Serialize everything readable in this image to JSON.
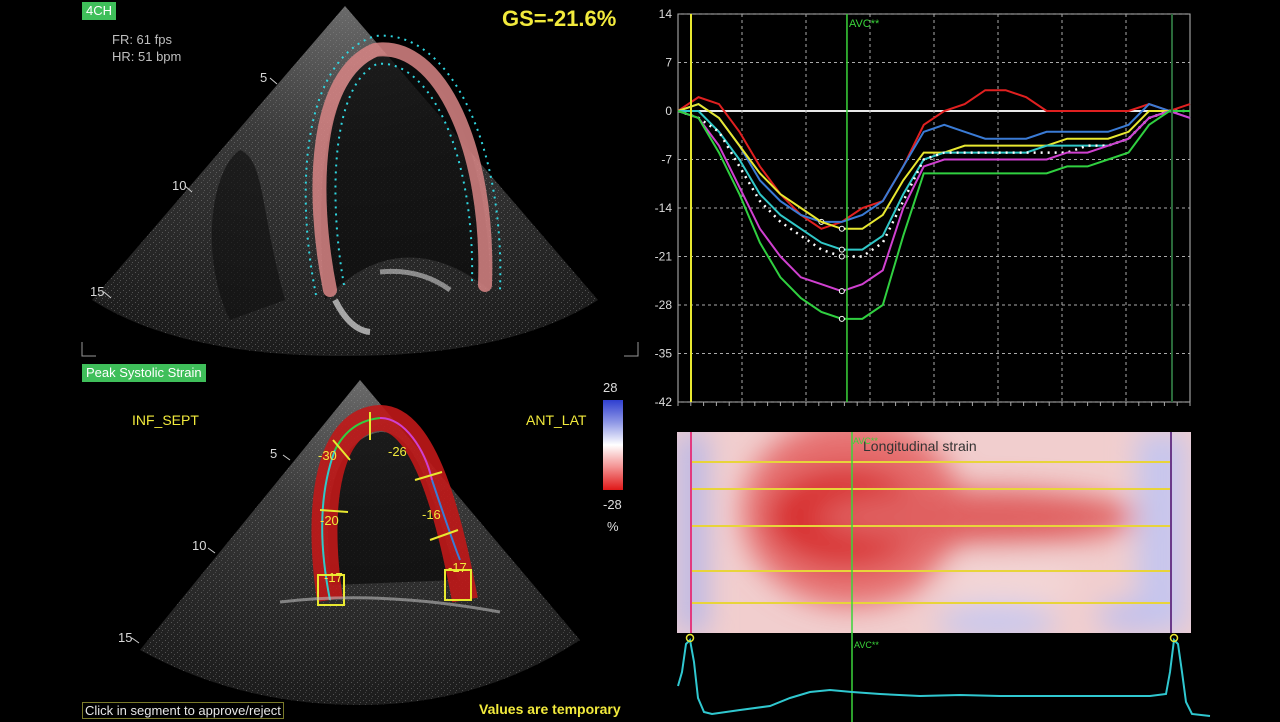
{
  "top_view": {
    "view_label": "4CH",
    "fr": "FR: 61 fps",
    "hr": "HR: 51 bpm",
    "depth_marks": [
      "5",
      "10",
      "15"
    ]
  },
  "gs_value": "GS=-21.6%",
  "bottom_view": {
    "mode_label": "Peak Systolic Strain",
    "left_wall": "INF_SEPT",
    "right_wall": "ANT_LAT",
    "depth_marks": [
      "5",
      "10",
      "15"
    ],
    "segment_values": [
      "-30",
      "-26",
      "-20",
      "-16",
      "-17",
      "-17"
    ],
    "colorbar_max": "28",
    "colorbar_min": "-28",
    "colorbar_unit": "%",
    "colors": {
      "positive": "#2f3fd0",
      "negative": "#e01818"
    }
  },
  "footer": {
    "instruction": "Click in segment to approve/reject",
    "status": "Values are temporary"
  },
  "chart_data": {
    "type": "line",
    "ylabel": "",
    "xlabel": "",
    "ylim": [
      -42,
      14
    ],
    "yticks": [
      "14",
      "7",
      "0",
      "-7",
      "-14",
      "-21",
      "-28",
      "-35",
      "-42"
    ],
    "marker_label": "AVC**",
    "x": [
      0,
      0.04,
      0.08,
      0.12,
      0.16,
      0.2,
      0.24,
      0.28,
      0.32,
      0.36,
      0.4,
      0.44,
      0.48,
      0.52,
      0.56,
      0.6,
      0.64,
      0.68,
      0.72,
      0.76,
      0.8,
      0.84,
      0.88,
      0.92,
      0.96,
      1.0
    ],
    "avc_x": 0.33,
    "series": [
      {
        "color": "#e02020",
        "values": [
          0,
          2,
          1,
          -3,
          -8,
          -12,
          -15,
          -17,
          -16,
          -14,
          -13,
          -8,
          -2,
          0,
          1,
          3,
          3,
          2,
          0,
          0,
          0,
          0,
          0,
          1,
          0,
          1
        ]
      },
      {
        "color": "#3a7bd5",
        "values": [
          0,
          1,
          -1,
          -5,
          -10,
          -13,
          -15,
          -16,
          -16,
          -15,
          -13,
          -8,
          -3,
          -2,
          -3,
          -4,
          -4,
          -4,
          -3,
          -3,
          -3,
          -3,
          -2,
          1,
          0,
          -1
        ]
      },
      {
        "color": "#e8e830",
        "values": [
          0,
          1,
          -1,
          -5,
          -9,
          -12,
          -14,
          -16,
          -17,
          -17,
          -15,
          -10,
          -6,
          -6,
          -5,
          -5,
          -5,
          -5,
          -5,
          -4,
          -4,
          -4,
          -3,
          0,
          0,
          0
        ]
      },
      {
        "color": "#30c8c8",
        "values": [
          0,
          0,
          -3,
          -7,
          -12,
          -15,
          -17,
          -19,
          -20,
          -20,
          -18,
          -12,
          -7,
          -6,
          -6,
          -6,
          -6,
          -6,
          -5,
          -5,
          -5,
          -5,
          -4,
          -1,
          0,
          0
        ]
      },
      {
        "color": "#ffffff",
        "values": [
          0,
          -1,
          -3,
          -8,
          -13,
          -16,
          -18,
          -20,
          -21,
          -21,
          -19,
          -13,
          -7,
          -6,
          -6,
          -6,
          -6,
          -6,
          -6,
          -6,
          -5,
          -5,
          -4,
          -1,
          0,
          0
        ]
      },
      {
        "color": "#d040d0",
        "values": [
          0,
          -1,
          -5,
          -11,
          -17,
          -21,
          -24,
          -25,
          -26,
          -25,
          -23,
          -14,
          -8,
          -7,
          -7,
          -7,
          -7,
          -7,
          -7,
          -6,
          -6,
          -5,
          -4,
          -1,
          0,
          -1
        ]
      },
      {
        "color": "#30d040",
        "values": [
          0,
          -1,
          -6,
          -12,
          -19,
          -24,
          -27,
          -29,
          -30,
          -30,
          -28,
          -18,
          -9,
          -9,
          -9,
          -9,
          -9,
          -9,
          -9,
          -8,
          -8,
          -7,
          -6,
          -2,
          0,
          0
        ]
      }
    ]
  },
  "heatmap": {
    "title": "Longitudinal strain",
    "marker_label": "AVC**"
  },
  "ecg": {
    "marker_label": "AVC**"
  }
}
